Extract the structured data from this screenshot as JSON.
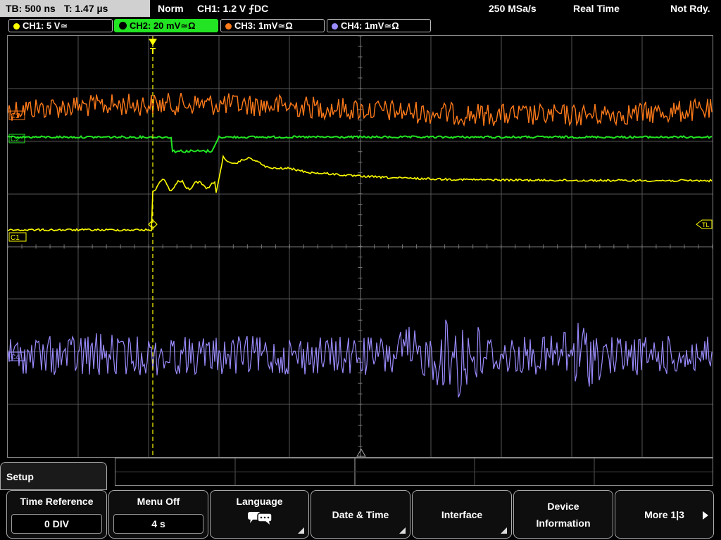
{
  "top": {
    "timebase": "TB: 500 ns",
    "trigger_time": "T: 1.47 µs",
    "mode": "Norm",
    "trigger_info": "CH1: 1.2 V ⨍DC",
    "sample_rate": "250 MSa/s",
    "acq_mode": "Real Time",
    "status": "Not Rdy."
  },
  "channels": [
    {
      "label": "CH1: 5 V≃",
      "color": "#ffff00",
      "active": false
    },
    {
      "label": "CH2: 20 mV≃Ω",
      "color": "#22e422",
      "active": true
    },
    {
      "label": "CH3: 1mV≃Ω",
      "color": "#ff8800",
      "active": false
    },
    {
      "label": "CH4: 1mV≃Ω",
      "color": "#9a8cff",
      "active": false
    }
  ],
  "markers": {
    "ch1": "C1",
    "ch2": "C2",
    "ch3": "C3",
    "ch4": "C4",
    "trigger_level": "TL"
  },
  "menu": {
    "tab_title": "Setup",
    "keys": [
      {
        "title": "Time Reference",
        "value": "0 DIV"
      },
      {
        "title": "Menu Off",
        "value": "4 s"
      },
      {
        "title": "Language",
        "icon": "speech-bubbles-icon"
      },
      {
        "title": "Date & Time"
      },
      {
        "title": "Interface"
      },
      {
        "title": "Device",
        "title2": "Information"
      },
      {
        "title": "More 1|3"
      }
    ]
  },
  "colors": {
    "ch1": "#ffff00",
    "ch2": "#22e422",
    "ch3": "#ff7a1a",
    "ch4": "#9a8cff",
    "grid": "#555555"
  }
}
